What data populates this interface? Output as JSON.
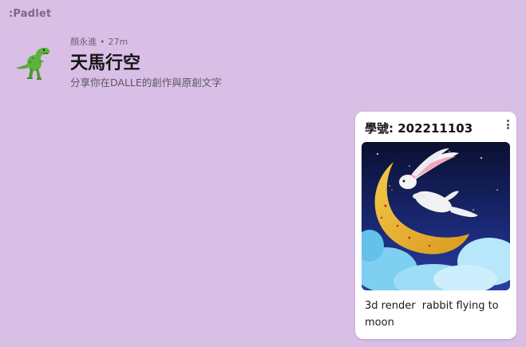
{
  "app": {
    "logo_text": ":Padlet"
  },
  "header": {
    "author": "顏永進",
    "time_ago": "27m",
    "title": "天馬行空",
    "subtitle": "分享你在DALLE的創作與原創文字",
    "avatar_icon": "dinosaur-icon"
  },
  "post": {
    "title": "學號: 202211103",
    "menu_icon": "more-vertical-icon",
    "image_subject": "rabbit-on-moon-image",
    "text": "3d render  rabbit flying to moon"
  },
  "colors": {
    "background": "#d9bfe6",
    "card": "#ffffff"
  }
}
